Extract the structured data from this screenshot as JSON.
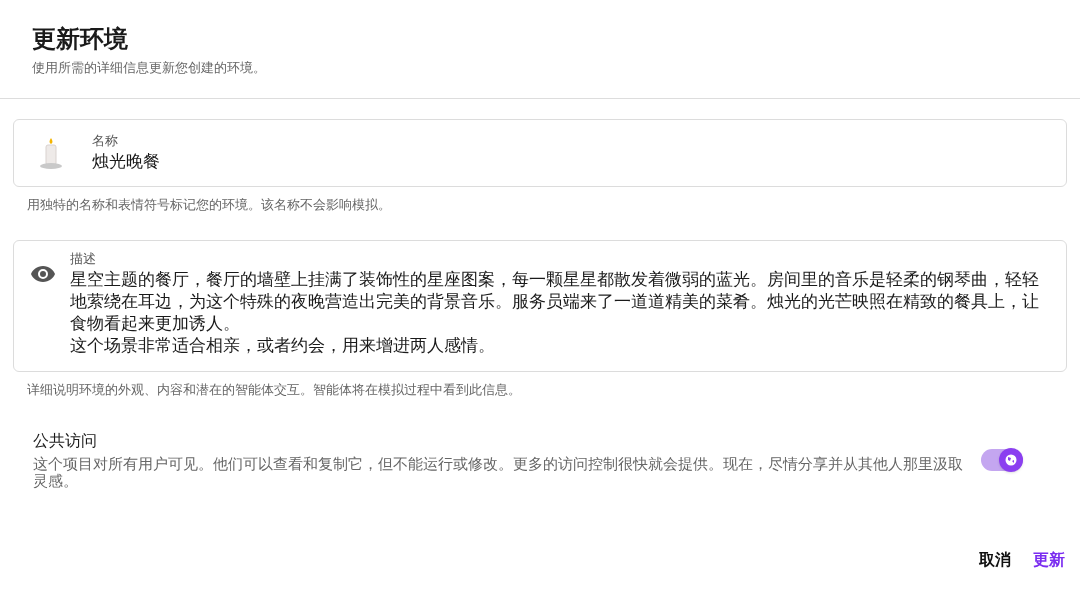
{
  "dialog": {
    "title": "更新环境",
    "subtitle": "使用所需的详细信息更新您创建的环境。"
  },
  "name_field": {
    "label": "名称",
    "value": "烛光晚餐",
    "help": "用独特的名称和表情符号标记您的环境。该名称不会影响模拟。"
  },
  "description_field": {
    "label": "描述",
    "paragraphs": [
      "星空主题的餐厅，餐厅的墙壁上挂满了装饰性的星座图案，每一颗星星都散发着微弱的蓝光。房间里的音乐是轻柔的钢琴曲，轻轻地萦绕在耳边，为这个特殊的夜晚营造出完美的背景音乐。服务员端来了一道道精美的菜肴。烛光的光芒映照在精致的餐具上，让食物看起来更加诱人。",
      "这个场景非常适合相亲，或者约会，用来增进两人感情。"
    ],
    "help": "详细说明环境的外观、内容和潜在的智能体交互。智能体将在模拟过程中看到此信息。"
  },
  "public_access": {
    "title": "公共访问",
    "description": "这个项目对所有用户可见。他们可以查看和复制它，但不能运行或修改。更多的访问控制很快就会提供。现在，尽情分享并从其他人那里汲取灵感。",
    "on": true
  },
  "buttons": [
    {
      "label": "取消",
      "kind": "secondary"
    },
    {
      "label": "更新",
      "kind": "primary"
    }
  ]
}
